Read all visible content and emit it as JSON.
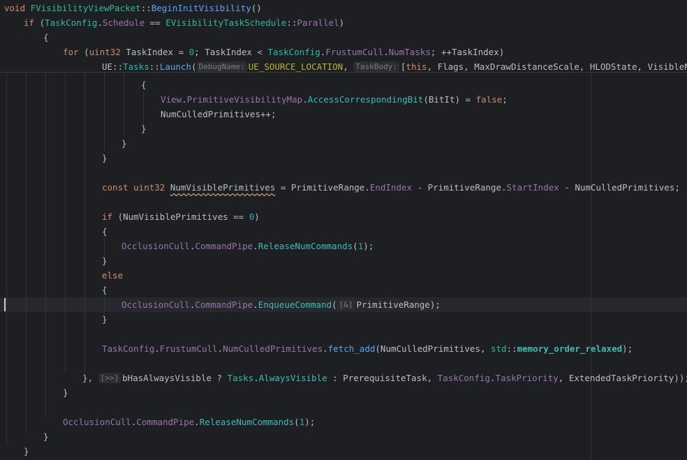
{
  "editor": {
    "sticky": {
      "l1": {
        "k": "void ",
        "cls": "FVisibilityViewPacket",
        "sep": "::",
        "fn": "BeginInitVisibility",
        "end": "()"
      },
      "l2": {
        "k": "if ",
        "p1": "(",
        "a": "TaskConfig",
        "d": ".",
        "b": "Schedule",
        "op": " == ",
        "c": "EVisibilityTaskSchedule",
        "sep": "::",
        "e": "Parallel",
        "p2": ")"
      },
      "l3": {
        "t": "{"
      },
      "l4": {
        "k": "for ",
        "p1": "(",
        "ty": "uint32",
        "p2": " TaskIndex = ",
        "n0": "0",
        "p3": "; TaskIndex < ",
        "a": "TaskConfig",
        "d1": ".",
        "b": "FrustumCull",
        "d2": ".",
        "c": "NumTasks",
        "p4": "; ++TaskIndex)"
      },
      "l5": {
        "ns": "UE",
        "s1": "::",
        "ns2": "Tasks",
        "s2": "::",
        "fn": "Launch",
        "p1": "(",
        "hint1": "DebugName:",
        "mac": "UE_SOURCE_LOCATION",
        "p2": ", ",
        "hint2": "TaskBody:",
        "p3": "[",
        "k": "this",
        "rest": ", Flags, MaxDrawDistanceScale, HLODState, VisibleNodes, Ta"
      }
    },
    "code": {
      "c1": {
        "t": "{"
      },
      "c2": {
        "a": "View",
        "d1": ".",
        "b": "PrimitiveVisibilityMap",
        "d2": ".",
        "fn": "AccessCorrespondingBit",
        "p1": "(BitIt) = ",
        "k": "false",
        "p2": ";"
      },
      "c3": {
        "t": "NumCulledPrimitives++;"
      },
      "c4": {
        "t": "}"
      },
      "c5": {
        "t": "}"
      },
      "c6": {
        "t": "}"
      },
      "c7": {
        "k": "const ",
        "ty": "uint32",
        "sp": " ",
        "v": "NumVisiblePrimitives",
        "p1": " = PrimitiveRange.",
        "a": "EndIndex",
        "p2": " - PrimitiveRange.",
        "b": "StartIndex",
        "p3": " - NumCulledPrimitives;"
      },
      "c8": {
        "k": "if ",
        "p1": "(NumVisiblePrimitives == ",
        "n": "0",
        "p2": ")"
      },
      "c9": {
        "t": "{"
      },
      "c10": {
        "a": "OcclusionCull",
        "d1": ".",
        "b": "CommandPipe",
        "d2": ".",
        "fn": "ReleaseNumCommands",
        "p1": "(",
        "n": "1",
        "p2": ");"
      },
      "c11": {
        "t": "}"
      },
      "c12": {
        "k": "else"
      },
      "c13": {
        "t": "{"
      },
      "c14": {
        "a": "OcclusionCull",
        "d1": ".",
        "b": "CommandPipe",
        "d2": ".",
        "fn": "EnqueueCommand",
        "p1": "(",
        "hint": "[&]",
        "p2": "PrimitiveRange);"
      },
      "c15": {
        "t": "}"
      },
      "c16": {
        "a": "TaskConfig",
        "d1": ".",
        "b": "FrustumCull",
        "d2": ".",
        "c": "NumCulledPrimitives",
        "d3": ".",
        "fn": "fetch_add",
        "p1": "(NumCulledPrimitives, ",
        "ns": "std",
        "s": "::",
        "mo": "memory_order_relaxed",
        "p2": ");"
      },
      "c17": {
        "p0": "}, ",
        "hint": "[>>]",
        "p1": "bHasAlwaysVisible ? ",
        "a": "Tasks",
        "d1": ".",
        "b": "AlwaysVisible",
        "p2": " : PrerequisiteTask, ",
        "c": "TaskConfig",
        "d2": ".",
        "e": "TaskPriority",
        "p3": ", ExtendedTaskPriority));"
      },
      "c18": {
        "t": "}"
      },
      "c19": {
        "a": "OcclusionCull",
        "d1": ".",
        "b": "CommandPipe",
        "d2": ".",
        "fn": "ReleaseNumCommands",
        "p1": "(",
        "n": "1",
        "p2": ");"
      },
      "c20": {
        "t": "}"
      },
      "c21": {
        "t": "}"
      }
    }
  }
}
